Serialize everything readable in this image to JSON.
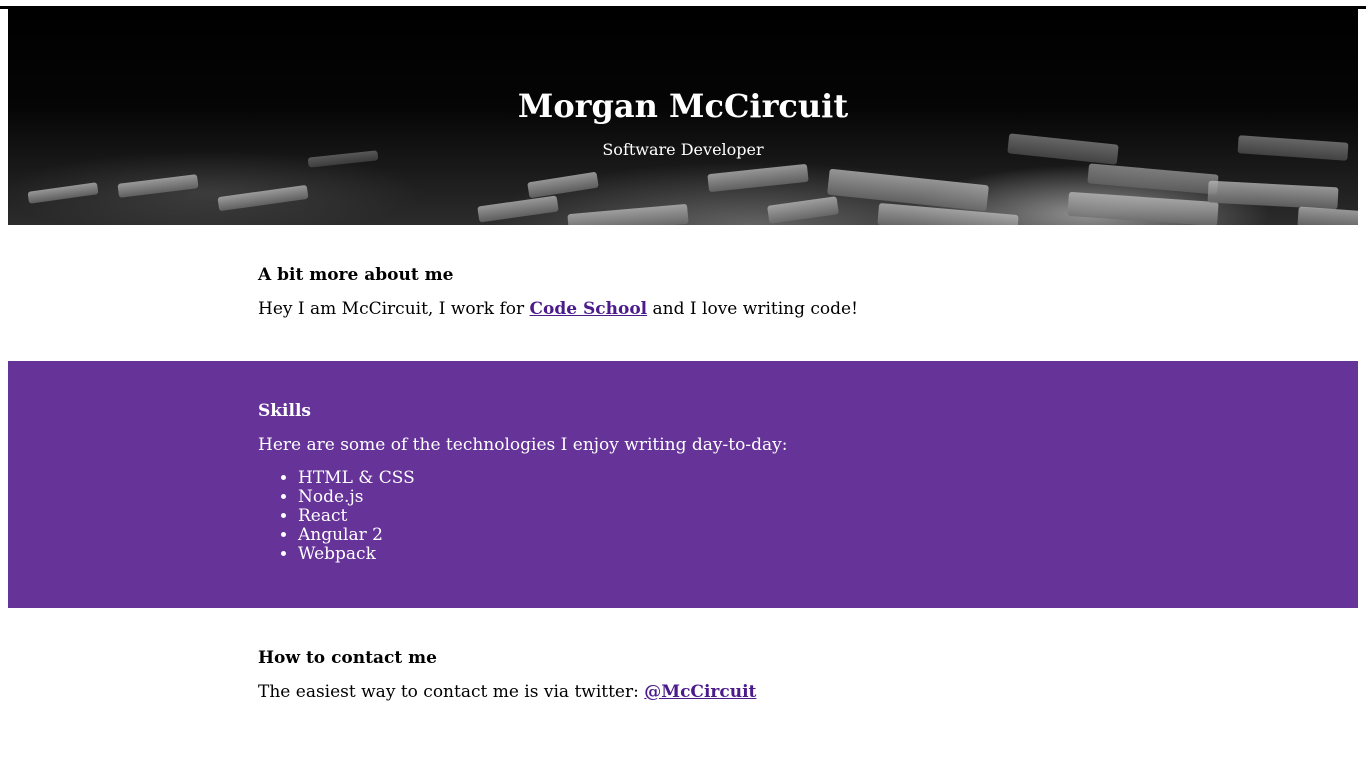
{
  "header": {
    "name": "Morgan McCircuit",
    "subtitle": "Software Developer"
  },
  "about": {
    "heading": "A bit more about me",
    "text_before": "Hey I am McCircuit, I work for ",
    "link_label": "Code School",
    "text_after": " and I love writing code!"
  },
  "skills": {
    "heading": "Skills",
    "intro": "Here are some of the technologies I enjoy writing day-to-day:",
    "items": [
      "HTML & CSS",
      "Node.js",
      "React",
      "Angular 2",
      "Webpack"
    ]
  },
  "contact": {
    "heading": "How to contact me",
    "text_before": "The easiest way to contact me is via twitter: ",
    "link_label": "@McCircuit"
  },
  "colors": {
    "skills_background": "#663399",
    "link": "#4b1a8b",
    "text": "#000000",
    "hero_text": "#ffffff"
  }
}
